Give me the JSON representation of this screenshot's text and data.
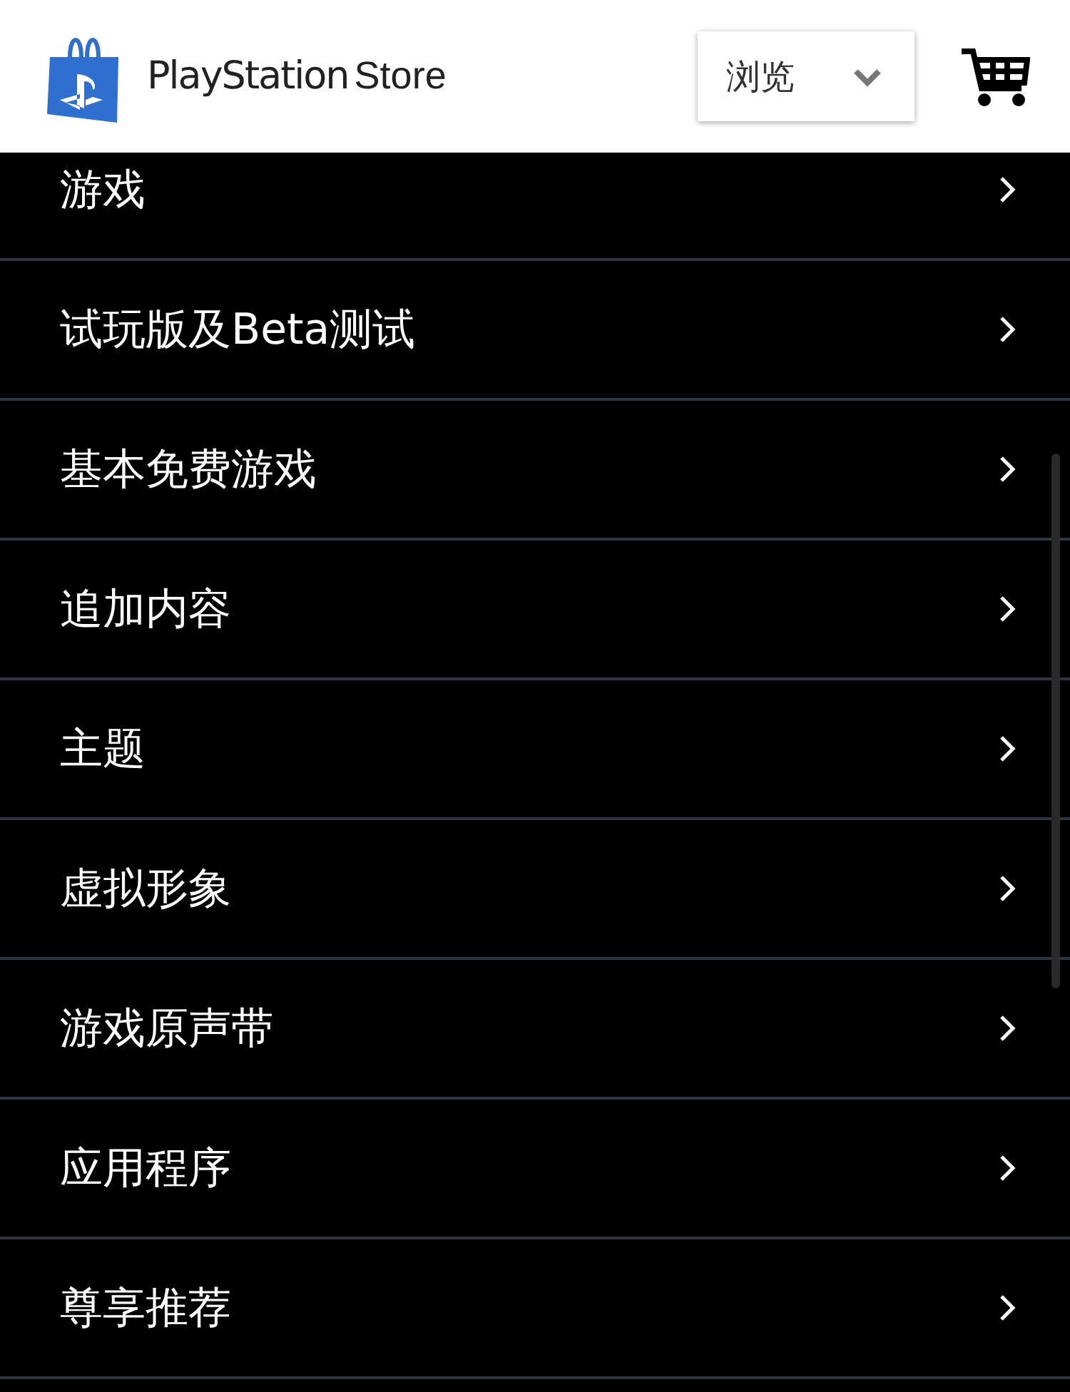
{
  "header": {
    "logo": {
      "brand": "PlayStation",
      "store": "Store"
    },
    "browse_menu": {
      "label": "浏览"
    }
  },
  "categories": [
    {
      "label": "游戏"
    },
    {
      "label": "试玩版及Beta测试"
    },
    {
      "label": "基本免费游戏"
    },
    {
      "label": "追加内容"
    },
    {
      "label": "主题"
    },
    {
      "label": "虚拟形象"
    },
    {
      "label": "游戏原声带"
    },
    {
      "label": "应用程序"
    },
    {
      "label": "尊享推荐"
    }
  ]
}
